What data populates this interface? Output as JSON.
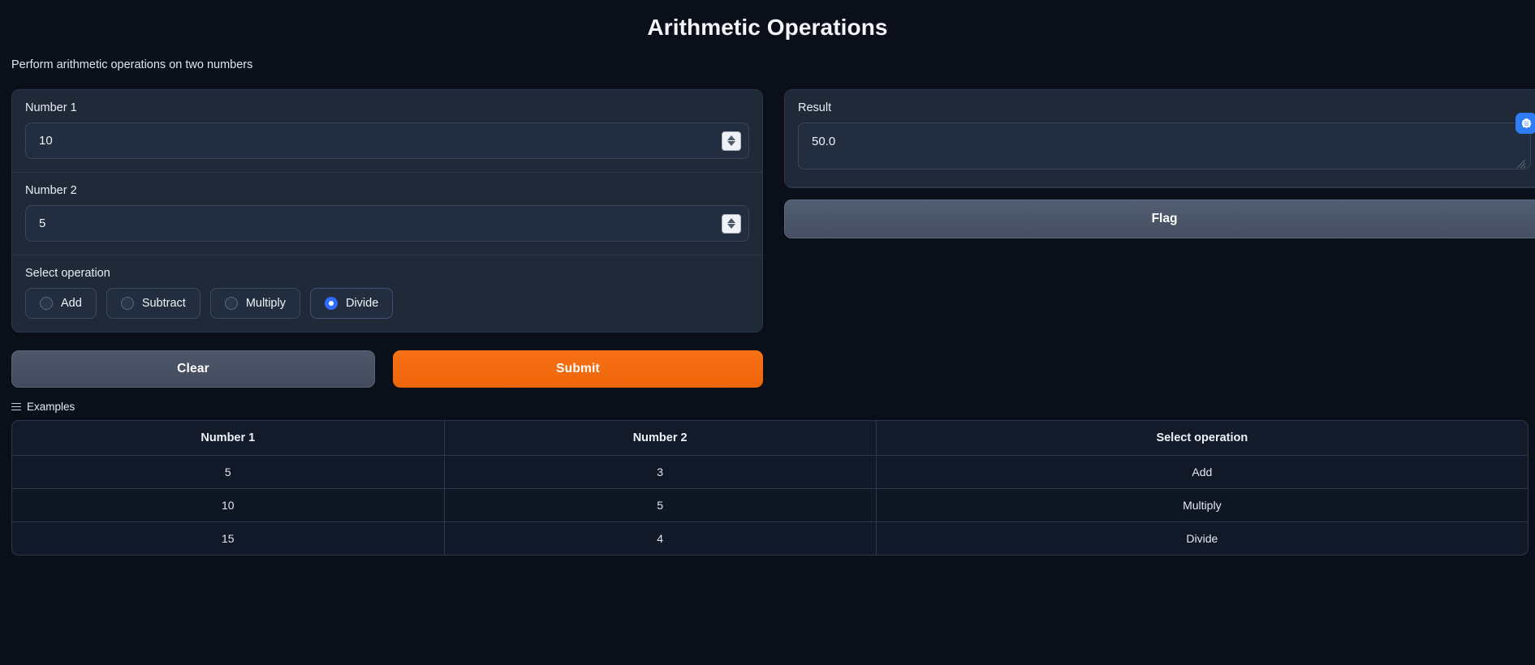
{
  "header": {
    "title": "Arithmetic Operations",
    "subtitle": "Perform arithmetic operations on two numbers"
  },
  "form": {
    "number1": {
      "label": "Number 1",
      "value": "10"
    },
    "number2": {
      "label": "Number 2",
      "value": "5"
    },
    "operation": {
      "label": "Select operation",
      "options": [
        "Add",
        "Subtract",
        "Multiply",
        "Divide"
      ],
      "selected": "Divide"
    },
    "buttons": {
      "clear": "Clear",
      "submit": "Submit"
    }
  },
  "output": {
    "result": {
      "label": "Result",
      "value": "50.0"
    },
    "flag_button": "Flag",
    "badge_icon": "brain-icon"
  },
  "examples": {
    "title": "Examples",
    "icon": "list-icon",
    "columns": [
      "Number 1",
      "Number 2",
      "Select operation"
    ],
    "rows": [
      [
        "5",
        "3",
        "Add"
      ],
      [
        "10",
        "5",
        "Multiply"
      ],
      [
        "15",
        "4",
        "Divide"
      ]
    ]
  },
  "colors": {
    "page_bg": "#0b0f19",
    "panel_bg": "#1f2937",
    "input_bg": "#222d3f",
    "accent_orange": "#f97116",
    "accent_blue": "#2f6bff",
    "badge_blue": "#2f7df6"
  }
}
